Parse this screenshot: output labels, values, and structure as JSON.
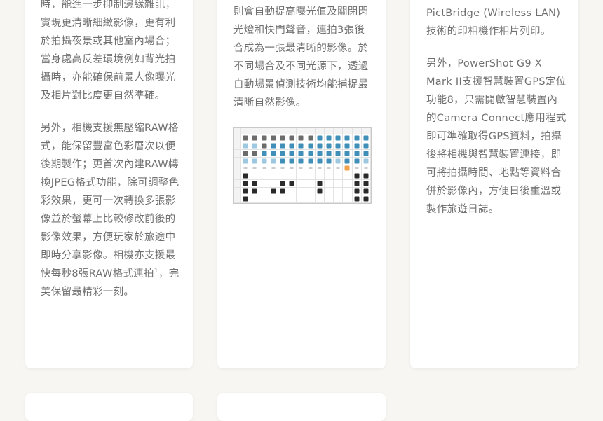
{
  "column1": {
    "para1": "時，能進一步抑制邊緣雜訊，實現更清晰細緻影像，更有利於拍攝夜景或其他室內場合；當身處高反差環境例如背光拍攝時，亦能確保前景人像曝光及相片對比度更自然準確。",
    "para2_main": "另外，相機支援無壓縮RAW格式，能保留豐富色彩層次以便後期製作；更首次內建RAW轉換JPEG格式功能，除可調整色彩效果，更可一次轉換多張影像並於螢幕上比較修改前後的影像效果，方便玩家於旅途中即時分享影像。相機亦支援最快每秒8張RAW格式連拍",
    "footnote_mark": "1",
    "para2_end": "，完美保留最精彩一刻。"
  },
  "column2": {
    "para1": "則會自動提高曝光值及關閉閃光燈和快門聲音，連拍3張後合成為一張最清晰的影像。於不同場合及不同光源下，透過自動場景偵測技術均能捕捉最清晰自然影像。"
  },
  "column3": {
    "para1": "無線連接至支援無線PictBridge (Wireless LAN) 技術的印相機作相片列印。",
    "para2": "另外，PowerShot G9 X Mark II支援智慧裝置GPS定位功能8，只需開啟智慧裝置內的Camera Connect應用程式即可準確取得GPS資料，拍攝後將相機與智慧裝置連接，即可將拍攝時間、地點等資料合併於影像內，方便日後重溫或製作旅遊日誌。"
  },
  "scene_table_image": {
    "icon_colors": {
      "blue": "#3f8fb8",
      "lightblue": "#9cc9df",
      "orange": "#f0a24d",
      "dark": "#2a2a2a"
    }
  }
}
